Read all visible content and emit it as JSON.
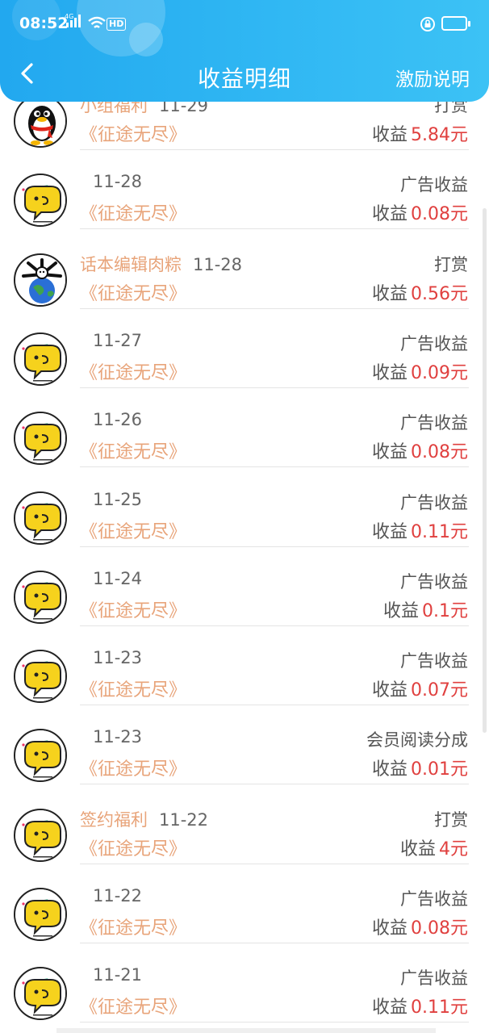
{
  "status_bar": {
    "time": "08:52",
    "network": "4G",
    "hd": "HD",
    "icons": [
      "signal-icon",
      "wifi-icon",
      "lock-rotation-icon",
      "battery-icon"
    ]
  },
  "header": {
    "title": "收益明细",
    "action": "激励说明",
    "back_icon": "chevron-left-icon"
  },
  "colors": {
    "header_start": "#22a8ef",
    "header_end": "#3cc2f5",
    "tag": "#e8a47a",
    "amount": "#e0403f"
  },
  "earn_prefix": "收益",
  "records": [
    {
      "avatar": "qq-penguin",
      "tag": "小组福利",
      "date": "11-29",
      "book": "《征途无尽》",
      "type": "打赏",
      "amount": "5.84元"
    },
    {
      "avatar": "chat-bubble",
      "tag": "",
      "date": "11-28",
      "book": "《征途无尽》",
      "type": "广告收益",
      "amount": "0.08元"
    },
    {
      "avatar": "globe-character",
      "tag": "话本编辑肉粽",
      "date": "11-28",
      "book": "《征途无尽》",
      "type": "打赏",
      "amount": "0.56元"
    },
    {
      "avatar": "chat-bubble",
      "tag": "",
      "date": "11-27",
      "book": "《征途无尽》",
      "type": "广告收益",
      "amount": "0.09元"
    },
    {
      "avatar": "chat-bubble",
      "tag": "",
      "date": "11-26",
      "book": "《征途无尽》",
      "type": "广告收益",
      "amount": "0.08元"
    },
    {
      "avatar": "chat-bubble",
      "tag": "",
      "date": "11-25",
      "book": "《征途无尽》",
      "type": "广告收益",
      "amount": "0.11元"
    },
    {
      "avatar": "chat-bubble",
      "tag": "",
      "date": "11-24",
      "book": "《征途无尽》",
      "type": "广告收益",
      "amount": "0.1元"
    },
    {
      "avatar": "chat-bubble",
      "tag": "",
      "date": "11-23",
      "book": "《征途无尽》",
      "type": "广告收益",
      "amount": "0.07元"
    },
    {
      "avatar": "chat-bubble",
      "tag": "",
      "date": "11-23",
      "book": "《征途无尽》",
      "type": "会员阅读分成",
      "amount": "0.01元"
    },
    {
      "avatar": "chat-bubble",
      "tag": "签约福利",
      "date": "11-22",
      "book": "《征途无尽》",
      "type": "打赏",
      "amount": "4元"
    },
    {
      "avatar": "chat-bubble",
      "tag": "",
      "date": "11-22",
      "book": "《征途无尽》",
      "type": "广告收益",
      "amount": "0.08元"
    },
    {
      "avatar": "chat-bubble",
      "tag": "",
      "date": "11-21",
      "book": "《征途无尽》",
      "type": "广告收益",
      "amount": "0.11元"
    }
  ]
}
